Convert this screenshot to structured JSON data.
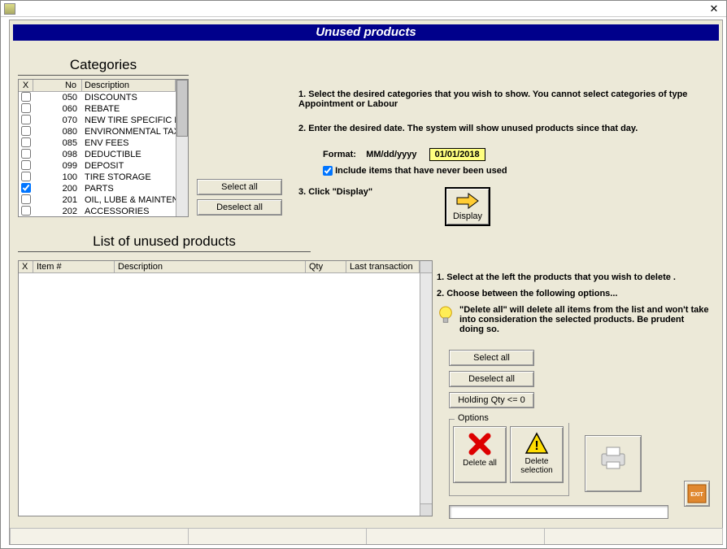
{
  "banner_title": "Unused products",
  "sections": {
    "categories_heading": "Categories",
    "list_heading": "List of unused products"
  },
  "category_columns": {
    "chk": "X",
    "no": "No",
    "desc": "Description"
  },
  "categories": [
    {
      "no": "050",
      "desc": "DISCOUNTS",
      "checked": false
    },
    {
      "no": "060",
      "desc": "REBATE",
      "checked": false
    },
    {
      "no": "070",
      "desc": "NEW TIRE SPECIFIC D",
      "checked": false
    },
    {
      "no": "080",
      "desc": "ENVIRONMENTAL TAX",
      "checked": false
    },
    {
      "no": "085",
      "desc": "ENV FEES",
      "checked": false
    },
    {
      "no": "098",
      "desc": "DEDUCTIBLE",
      "checked": false
    },
    {
      "no": "099",
      "desc": "DEPOSIT",
      "checked": false
    },
    {
      "no": "100",
      "desc": "TIRE STORAGE",
      "checked": false
    },
    {
      "no": "200",
      "desc": "PARTS",
      "checked": true
    },
    {
      "no": "201",
      "desc": "OIL, LUBE & MAINTENA",
      "checked": false
    },
    {
      "no": "202",
      "desc": "ACCESSORIES",
      "checked": false
    }
  ],
  "buttons": {
    "select_all": "Select all",
    "deselect_all": "Deselect all",
    "holding_qty": "Holding Qty <= 0",
    "display": "Display",
    "delete_all": "Delete all",
    "delete_selection": "Delete selection"
  },
  "instructions": {
    "step1": "1. Select the desired categories that you wish to show. You cannot select categories of type Appointment or Labour",
    "step2": "2. Enter the desired date. The system will show unused products since that day.",
    "format_label": "Format:",
    "format_value": "MM/dd/yyyy",
    "date_value": "01/01/2018",
    "include_never": "Include items that have never been used",
    "include_never_checked": true,
    "step3": "3. Click \"Display\""
  },
  "product_columns": {
    "chk": "X",
    "item": "Item #",
    "desc": "Description",
    "qty": "Qty",
    "last": "Last transaction"
  },
  "right_panel": {
    "line1": "1. Select at the left the products that you wish to delete .",
    "line2": "2. Choose between the following options...",
    "tip": "\"Delete all\" will delete all items from the list and won't take into consideration the selected products. Be prudent doing so."
  },
  "options_group_label": "Options",
  "icons": {
    "exit_label": "EXIT"
  }
}
